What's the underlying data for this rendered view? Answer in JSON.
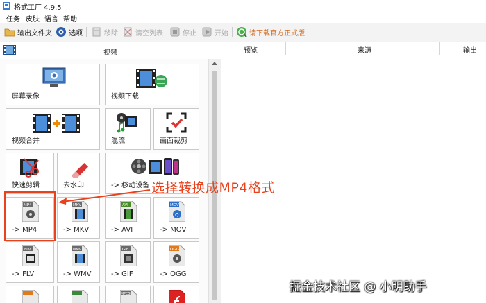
{
  "window": {
    "title": "格式工厂 4.9.5",
    "app_icon": "format-factory-icon"
  },
  "menu": [
    "任务",
    "皮肤",
    "语言",
    "帮助"
  ],
  "toolbar": {
    "output_folder": "输出文件夹",
    "options": "选项",
    "remove": "移除",
    "clear_list": "清空列表",
    "stop": "停止",
    "start": "开始",
    "download": "请下载官方正式版"
  },
  "category": {
    "label": "视频",
    "icon": "film-icon"
  },
  "tiles": {
    "screen_record": "屏幕录像",
    "video_download": "视频下载",
    "video_merge": "视频合并",
    "mix": "混流",
    "crop": "画面裁剪",
    "fast_cut": "快速剪辑",
    "watermark_remove": "去水印",
    "mobile": "-> 移动设备",
    "mp4": "-> MP4",
    "mkv": "-> MKV",
    "avi": "-> AVI",
    "mov": "-> MOV",
    "flv": "-> FLV",
    "wmv": "-> WMV",
    "gif": "-> GIF",
    "ogg": "-> OGG"
  },
  "badges": {
    "mp4": "MP4",
    "mkv": "MKV",
    "avi": "AVI",
    "mov": "MOV",
    "flv": "FLV",
    "wmv": "WMV",
    "gif": "GIF",
    "ogg": "OGG",
    "mpeg": "MPEG"
  },
  "list": {
    "columns": [
      "预览",
      "来源",
      "输出"
    ]
  },
  "annotation": "选择转换成MP4格式",
  "watermark": "掘金技术社区 @ 小明助手",
  "colors": {
    "accent": "#e8411c",
    "download_text": "#d2691e"
  }
}
